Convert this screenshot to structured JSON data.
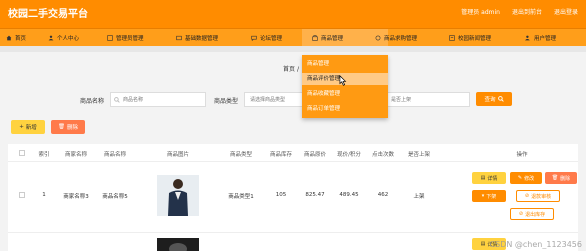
{
  "app": {
    "title": "校园二手交易平台"
  },
  "top_links": [
    "管理员 admin",
    "退出到前台",
    "退出登录"
  ],
  "nav": [
    {
      "label": "首页",
      "icon": "home-icon"
    },
    {
      "label": "个人中心",
      "icon": "user-icon"
    },
    {
      "label": "管理员管理",
      "icon": "admin-icon"
    },
    {
      "label": "基础数据管理",
      "icon": "data-icon"
    },
    {
      "label": "论坛管理",
      "icon": "forum-icon"
    },
    {
      "label": "商品管理",
      "icon": "goods-icon"
    },
    {
      "label": "商品求购管理",
      "icon": "request-icon"
    },
    {
      "label": "校园新闻管理",
      "icon": "news-icon"
    },
    {
      "label": "用户管理",
      "icon": "users-icon"
    }
  ],
  "dropdown": [
    "商品管理",
    "商品评价管理",
    "商品收藏管理",
    "商品订单管理"
  ],
  "breadcrumb": {
    "home": "首页",
    "sep": "/"
  },
  "search": {
    "name_label": "商品名称",
    "name_placeholder": "商品名称",
    "type_label": "商品类型",
    "type_placeholder": "请选择商品类型",
    "state_placeholder": "是否上架",
    "query_label": "查询"
  },
  "actions": {
    "add_label": "新增",
    "delete_label": "删除"
  },
  "table": {
    "headers": [
      "索引",
      "商家名称",
      "商品名称",
      "商品图片",
      "商品类型",
      "商品库存",
      "商品原价",
      "现价/积分",
      "点击次数",
      "是否上架",
      "操作"
    ],
    "rows": [
      {
        "index": "1",
        "seller": "商家名称3",
        "name": "商品名称5",
        "type": "商品类型1",
        "stock": "105",
        "price": "825.47",
        "now_price": "489.45",
        "clicks": "462",
        "state": "上架"
      }
    ],
    "ops": {
      "detail": "详情",
      "edit": "修改",
      "delete": "删除",
      "down": "下架",
      "refund": "退款审核",
      "ship": "退出库存"
    }
  },
  "watermark": "CSDN @chen_1123456"
}
